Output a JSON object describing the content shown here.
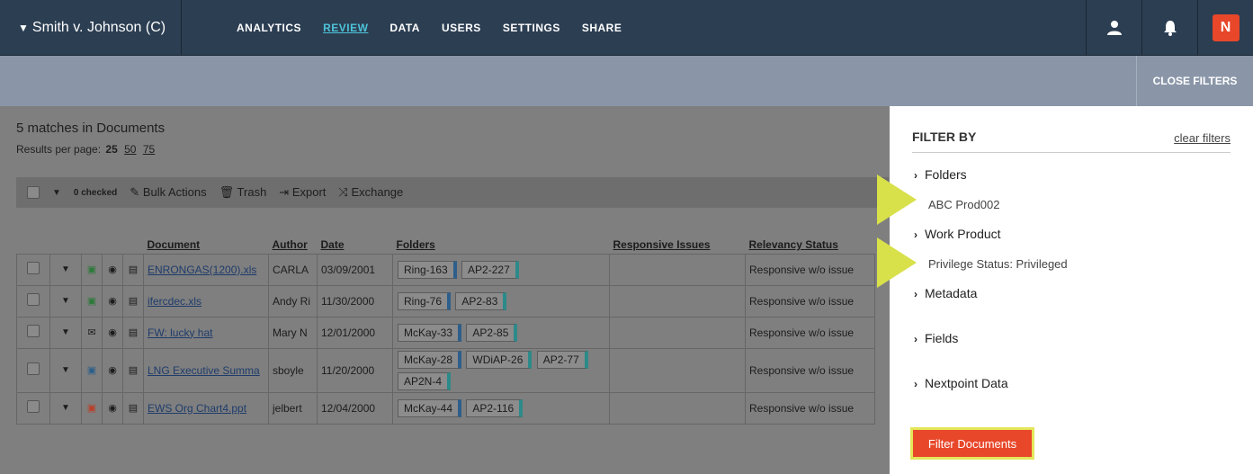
{
  "topbar": {
    "case_title": "Smith v. Johnson (C)",
    "nav": [
      "ANALYTICS",
      "REVIEW",
      "DATA",
      "USERS",
      "SETTINGS",
      "SHARE"
    ],
    "active_nav": "REVIEW",
    "logo_glyph": "N"
  },
  "filters_band": {
    "close_label": "CLOSE FILTERS"
  },
  "results": {
    "matches": "5 matches in Documents",
    "per_page_label": "Results per page:",
    "per_page_current": "25",
    "per_page_options": [
      "50",
      "75"
    ]
  },
  "toolbar": {
    "checked": "0 checked",
    "bulk_actions": "Bulk Actions",
    "trash": "Trash",
    "export": "Export",
    "exchange": "Exchange"
  },
  "table": {
    "headers": [
      "Document",
      "Author",
      "Date",
      "Folders",
      "Responsive Issues",
      "Relevancy Status"
    ],
    "rows": [
      {
        "type": "xls",
        "document": "ENRONGAS(1200).xls",
        "author": "CARLA",
        "date": "03/09/2001",
        "folders": [
          "Ring-163",
          "AP2-227"
        ],
        "status": "Responsive w/o issue"
      },
      {
        "type": "xls",
        "document": "ifercdec.xls",
        "author": "Andy Ri",
        "date": "11/30/2000",
        "folders": [
          "Ring-76",
          "AP2-83"
        ],
        "status": "Responsive w/o issue"
      },
      {
        "type": "email",
        "document": "FW: lucky hat",
        "author": "Mary N",
        "date": "12/01/2000",
        "folders": [
          "McKay-33",
          "AP2-85"
        ],
        "status": "Responsive w/o issue"
      },
      {
        "type": "doc",
        "document": "LNG Executive Summa",
        "author": "sboyle",
        "date": "11/20/2000",
        "folders": [
          "McKay-28",
          "WDiAP-26",
          "AP2-77",
          "AP2N-4"
        ],
        "status": "Responsive w/o issue"
      },
      {
        "type": "ppt",
        "document": "EWS Org Chart4.ppt",
        "author": "jelbert",
        "date": "12/04/2000",
        "folders": [
          "McKay-44",
          "AP2-116"
        ],
        "status": "Responsive w/o issue"
      }
    ]
  },
  "panel": {
    "title": "FILTER BY",
    "clear": "clear filters",
    "items": {
      "folders": "Folders",
      "folders_value": "ABC Prod002",
      "work_product": "Work Product",
      "work_product_value": "Privilege Status: Privileged",
      "metadata": "Metadata",
      "fields": "Fields",
      "nextpoint": "Nextpoint Data"
    },
    "button": "Filter Documents"
  },
  "colors": {
    "nav_bg": "#2c3e52",
    "accent": "#4ec3d9",
    "brand": "#e8472a",
    "highlight": "#d8e04a"
  }
}
